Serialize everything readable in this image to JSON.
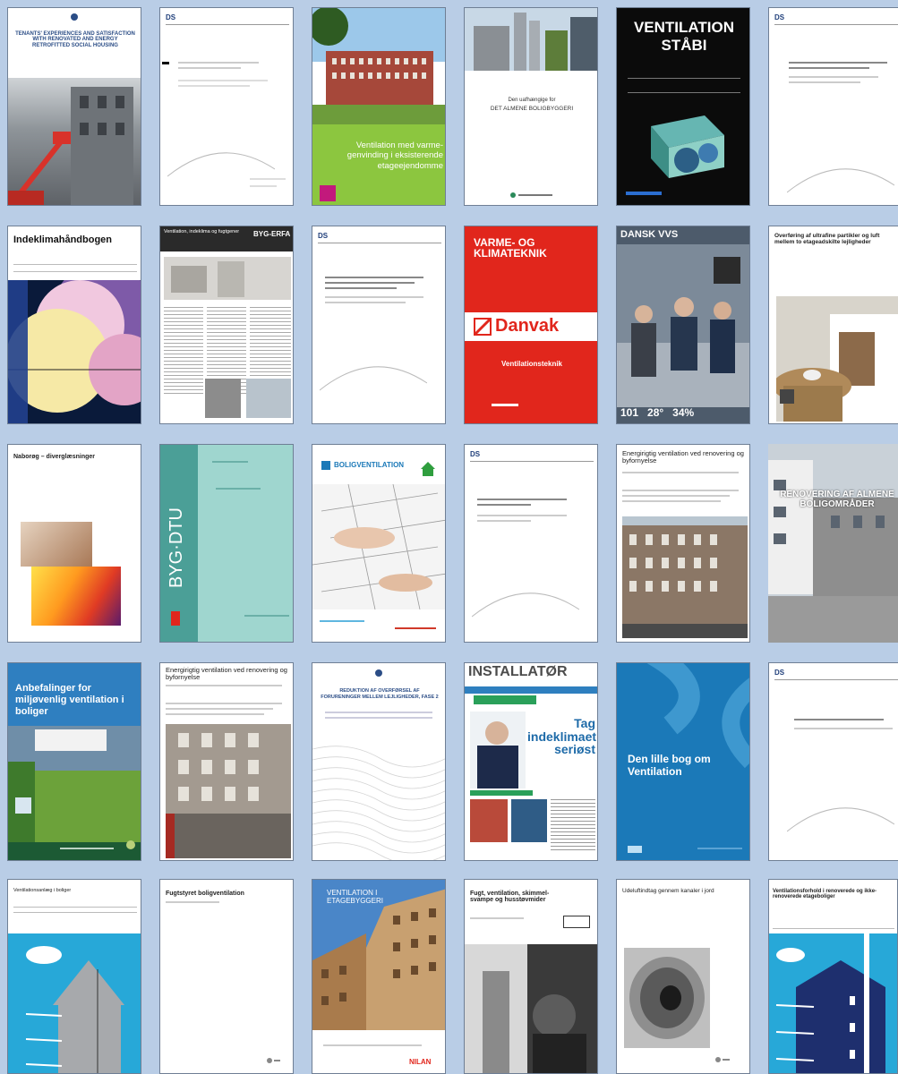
{
  "cards": {
    "c1": {
      "title": "TENANTS' EXPERIENCES AND SATISFACTION WITH RENOVATED AND ENERGY RETROFITTED SOCIAL HOUSING"
    },
    "c2": {
      "brand": "DS"
    },
    "c3": {
      "title": "Ventilation med varme-genvinding i eksisterende etageejendomme"
    },
    "c4": {
      "subtitle": "Den uafhængige for",
      "title": "DET ALMENE BOLIGBYGGERI"
    },
    "c5": {
      "title": "VENTILATION STÅBI"
    },
    "c6": {
      "brand": "DS"
    },
    "c7": {
      "title": "Indeklimahåndbogen"
    },
    "c8": {
      "title": "Ventilation, indeklima og fugtgener",
      "brand": "BYG-ERFA"
    },
    "c9": {
      "brand": "DS"
    },
    "c10": {
      "title": "VARME- OG KLIMATEKNIK",
      "brand": "Danvak",
      "subtitle": "Ventilationsteknik"
    },
    "c11": {
      "title": "DANSK VVS",
      "numbers": "101   28°   34%"
    },
    "c12": {
      "title": "Overføring af ultrafine partikler og luft mellem to etageadskilte lejligheder"
    },
    "c13": {
      "title": "Naborøg – diverglæsninger"
    },
    "c14": {
      "title": "BYG·DTU"
    },
    "c15": {
      "title": "BOLIGVENTILATION"
    },
    "c16": {
      "brand": "DS"
    },
    "c17": {
      "title": "Energirigtig ventilation ved renovering og byfornyelse"
    },
    "c18": {
      "title": "RENOVERING AF ALMENE BOLIGOMRÅDER"
    },
    "c19": {
      "title": "Anbefalinger for miljøvenlig ventilation i boliger"
    },
    "c20": {
      "title": "Energirigtig ventilation ved renovering og byfornyelse"
    },
    "c21": {
      "title": "REDUKTION AF OVERFØRSEL AF FORURENINGER MELLEM LEJLIGHEDER, FASE 2"
    },
    "c22": {
      "title": "INSTALLATØR",
      "headline": "Tag indeklimaet seriøst"
    },
    "c23": {
      "title": "Den lille bog om Ventilation"
    },
    "c24": {
      "brand": "DS"
    },
    "c25": {
      "title": "Ventilationsanlæg i boliger"
    },
    "c26": {
      "title": "Fugtstyret boligventilation"
    },
    "c27": {
      "title": "VENTILATION I ETAGEBYGGERI",
      "brand": "NILAN"
    },
    "c28": {
      "title": "Fugt, ventilation, skimmel-svampe og husstøvmider"
    },
    "c29": {
      "title": "Udeluftindtag gennem kanaler i jord"
    },
    "c30": {
      "title": "Ventilationsforhold i renoverede og ikke-renoverede etageboliger"
    }
  },
  "colors": {
    "background": "#b9cde6",
    "green": "#8cc63f",
    "red": "#e1261c",
    "blue": "#1b79b8",
    "sky": "#27a8d8",
    "teal": "#9fd6cf",
    "black": "#0b0b0b"
  }
}
